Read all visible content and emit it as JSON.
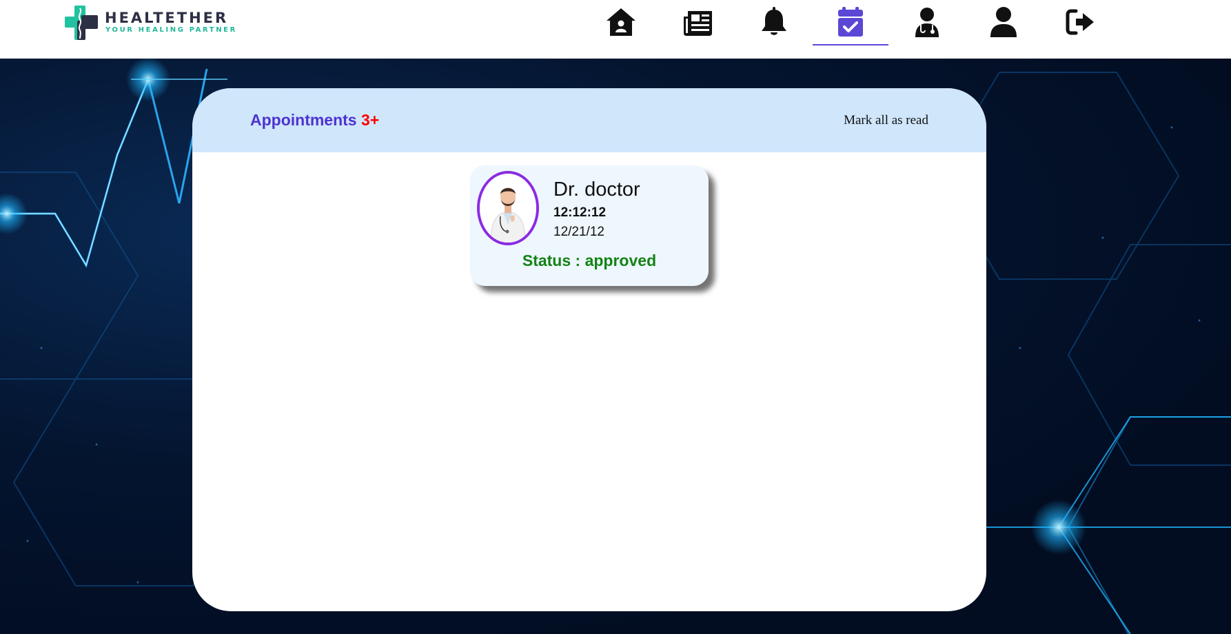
{
  "brand": {
    "name": "HEALTETHER",
    "tagline": "YOUR HEALING PARTNER"
  },
  "nav": {
    "items": [
      {
        "icon": "home-icon",
        "active": false
      },
      {
        "icon": "newspaper-icon",
        "active": false
      },
      {
        "icon": "bell-icon",
        "active": false
      },
      {
        "icon": "calendar-check-icon",
        "active": true
      },
      {
        "icon": "doctor-icon",
        "active": false
      },
      {
        "icon": "user-icon",
        "active": false
      },
      {
        "icon": "sign-out-icon",
        "active": false
      }
    ],
    "active_color": "#5b47d6"
  },
  "panel": {
    "title": "Appointments",
    "count": "3+",
    "mark_all_label": "Mark all as read"
  },
  "appointments": [
    {
      "doctor": "Dr. doctor",
      "time": "12:12:12",
      "date": "12/21/12",
      "status": "Status : approved"
    }
  ],
  "colors": {
    "title": "#4d33cf",
    "count": "#ff0000",
    "status_approved": "#148314",
    "avatar_ring": "#8a2be2",
    "panel_header": "#cfe6fb"
  }
}
